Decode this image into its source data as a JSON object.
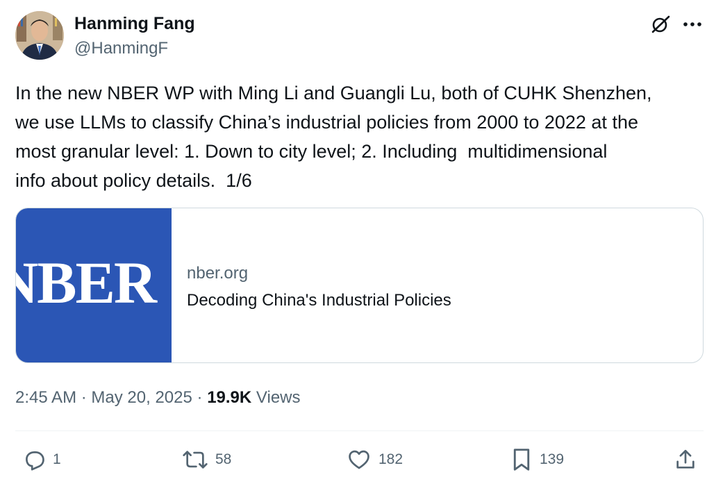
{
  "author": {
    "name": "Hanming Fang",
    "handle": "@HanmingF"
  },
  "header_icons": {
    "grok": "grok-icon",
    "more": "more-icon"
  },
  "tweet": {
    "text": "In the new NBER WP with Ming Li and Guangli Lu, both of CUHK Shenzhen,\nwe use LLMs to classify China’s industrial policies from 2000 to 2022 at the\nmost granular level: 1. Down to city level; 2. Including  multidimensional\ninfo about policy details.  1/6"
  },
  "link_card": {
    "logo_text": "NBER",
    "logo_color": "#2b56b5",
    "domain": "nber.org",
    "title": "Decoding China's Industrial Policies"
  },
  "meta": {
    "time": "2:45 AM",
    "separator": "·",
    "date": "May 20, 2025",
    "views_count": "19.9K",
    "views_label": "Views"
  },
  "actions": {
    "replies": "1",
    "reposts": "58",
    "likes": "182",
    "bookmarks": "139"
  },
  "colors": {
    "text_primary": "#0f1419",
    "text_secondary": "#536471",
    "border": "#cfd9de"
  }
}
